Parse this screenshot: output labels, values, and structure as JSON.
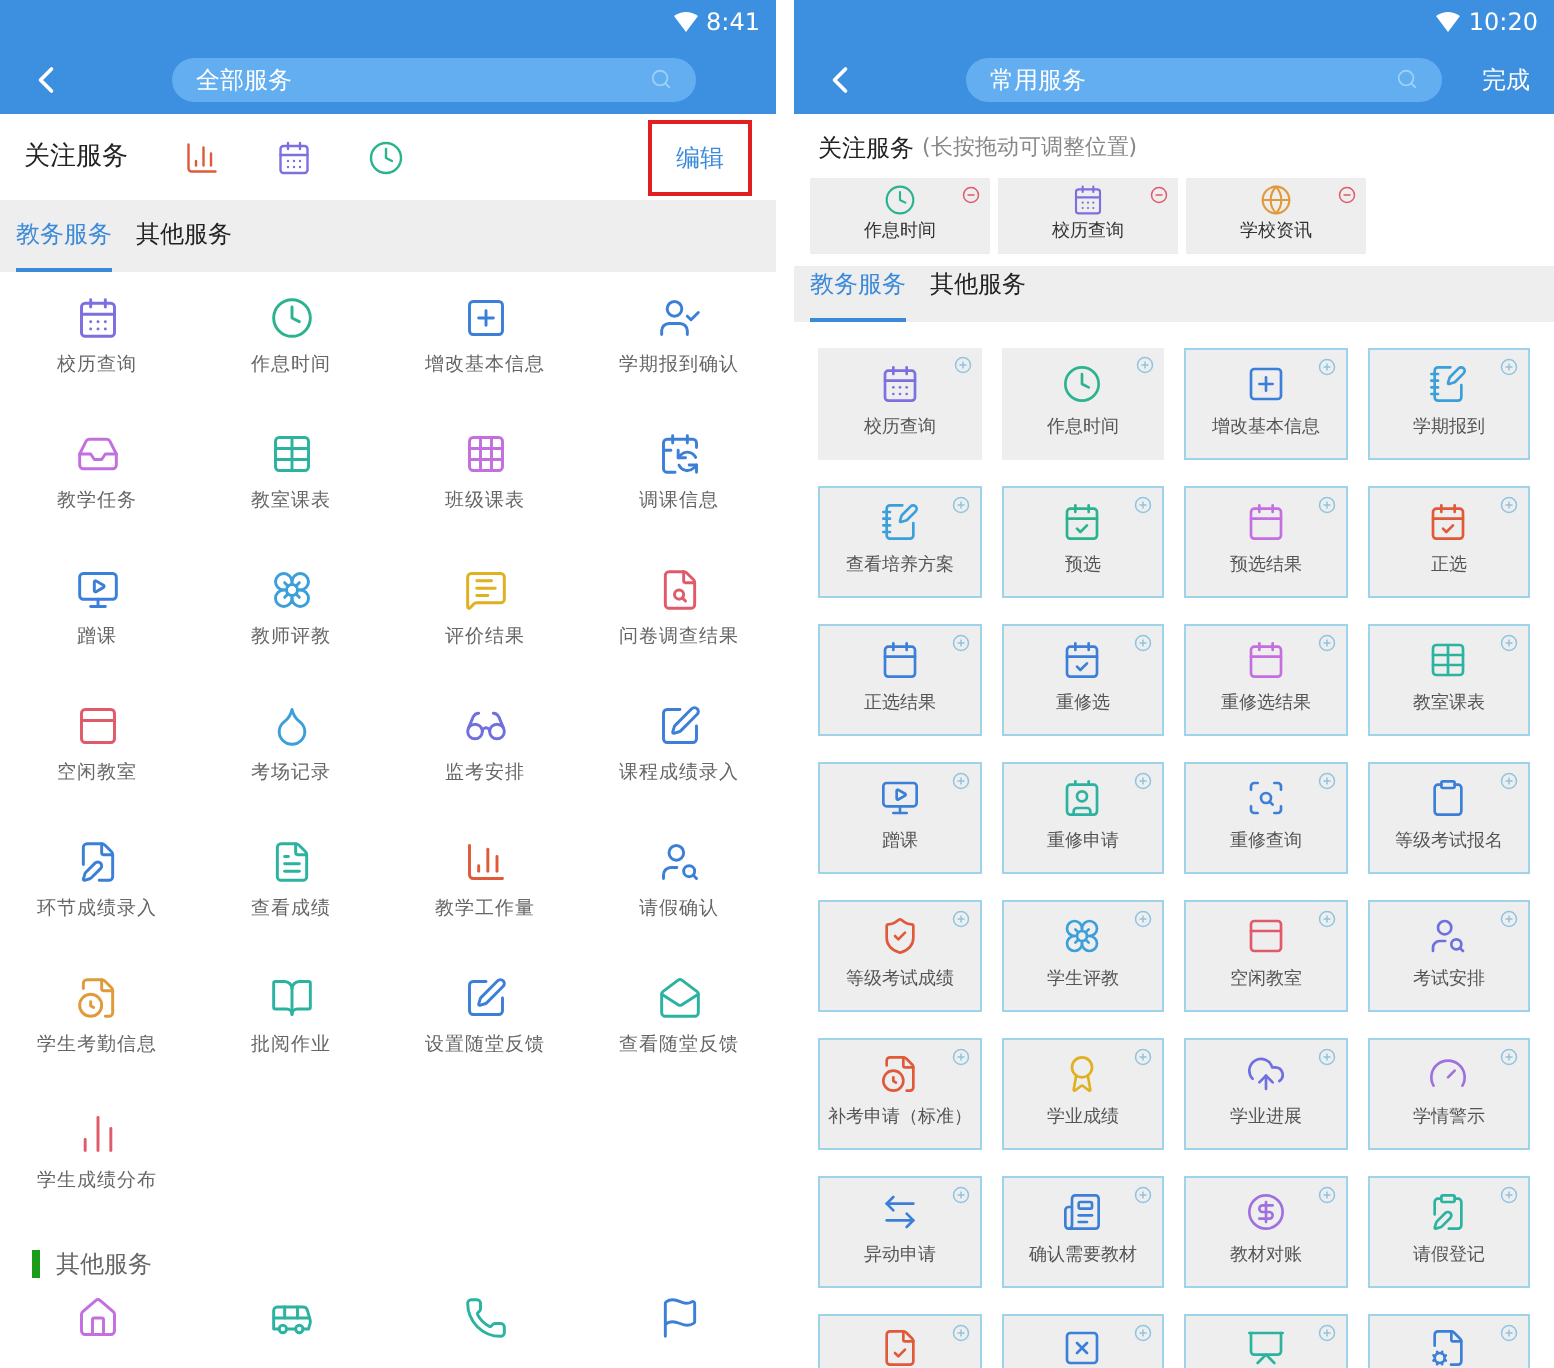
{
  "left_screen": {
    "status_bar": {
      "time": "8:41"
    },
    "header": {
      "search_value": "全部服务"
    },
    "favorites": {
      "title": "关注服务",
      "edit_button": {
        "label": "编辑",
        "annotated": true
      }
    },
    "tabs": [
      {
        "label": "教务服务",
        "selected": true
      },
      {
        "label": "其他服务",
        "selected": false
      }
    ],
    "services": [
      {
        "label": "校历查询"
      },
      {
        "label": "作息时间"
      },
      {
        "label": "增改基本信息"
      },
      {
        "label": "学期报到确认"
      },
      {
        "label": "教学任务"
      },
      {
        "label": "教室课表"
      },
      {
        "label": "班级课表"
      },
      {
        "label": "调课信息"
      },
      {
        "label": "蹭课"
      },
      {
        "label": "教师评教"
      },
      {
        "label": "评价结果"
      },
      {
        "label": "问卷调查结果"
      },
      {
        "label": "空闲教室"
      },
      {
        "label": "考场记录"
      },
      {
        "label": "监考安排"
      },
      {
        "label": "课程成绩录入"
      },
      {
        "label": "环节成绩录入"
      },
      {
        "label": "查看成绩"
      },
      {
        "label": "教学工作量"
      },
      {
        "label": "请假确认"
      },
      {
        "label": "学生考勤信息"
      },
      {
        "label": "批阅作业"
      },
      {
        "label": "设置随堂反馈"
      },
      {
        "label": "查看随堂反馈"
      },
      {
        "label": "学生成绩分布"
      }
    ],
    "other_section": {
      "title": "其他服务"
    }
  },
  "right_screen": {
    "status_bar": {
      "time": "10:20"
    },
    "header": {
      "search_value": "常用服务",
      "done_button": "完成"
    },
    "favorites": {
      "title": "关注服务",
      "hint": "(长按拖动可调整位置)",
      "items": [
        {
          "label": "作息时间"
        },
        {
          "label": "校历查询"
        },
        {
          "label": "学校资讯"
        }
      ]
    },
    "tabs": [
      {
        "label": "教务服务",
        "selected": true
      },
      {
        "label": "其他服务",
        "selected": false
      }
    ],
    "services": [
      {
        "label": "校历查询",
        "in_favorites": true
      },
      {
        "label": "作息时间",
        "in_favorites": true
      },
      {
        "label": "增改基本信息",
        "in_favorites": false
      },
      {
        "label": "学期报到",
        "in_favorites": false
      },
      {
        "label": "查看培养方案",
        "in_favorites": false
      },
      {
        "label": "预选",
        "in_favorites": false
      },
      {
        "label": "预选结果",
        "in_favorites": false
      },
      {
        "label": "正选",
        "in_favorites": false
      },
      {
        "label": "正选结果",
        "in_favorites": false
      },
      {
        "label": "重修选",
        "in_favorites": false
      },
      {
        "label": "重修选结果",
        "in_favorites": false
      },
      {
        "label": "教室课表",
        "in_favorites": false
      },
      {
        "label": "蹭课",
        "in_favorites": false
      },
      {
        "label": "重修申请",
        "in_favorites": false
      },
      {
        "label": "重修查询",
        "in_favorites": false
      },
      {
        "label": "等级考试报名",
        "in_favorites": false
      },
      {
        "label": "等级考试成绩",
        "in_favorites": false
      },
      {
        "label": "学生评教",
        "in_favorites": false
      },
      {
        "label": "空闲教室",
        "in_favorites": false
      },
      {
        "label": "考试安排",
        "in_favorites": false
      },
      {
        "label": "补考申请（标准）",
        "in_favorites": false
      },
      {
        "label": "学业成绩",
        "in_favorites": false
      },
      {
        "label": "学业进展",
        "in_favorites": false
      },
      {
        "label": "学情警示",
        "in_favorites": false
      },
      {
        "label": "异动申请",
        "in_favorites": false
      },
      {
        "label": "确认需要教材",
        "in_favorites": false
      },
      {
        "label": "教材对账",
        "in_favorites": false
      },
      {
        "label": "请假登记",
        "in_favorites": false
      }
    ]
  }
}
